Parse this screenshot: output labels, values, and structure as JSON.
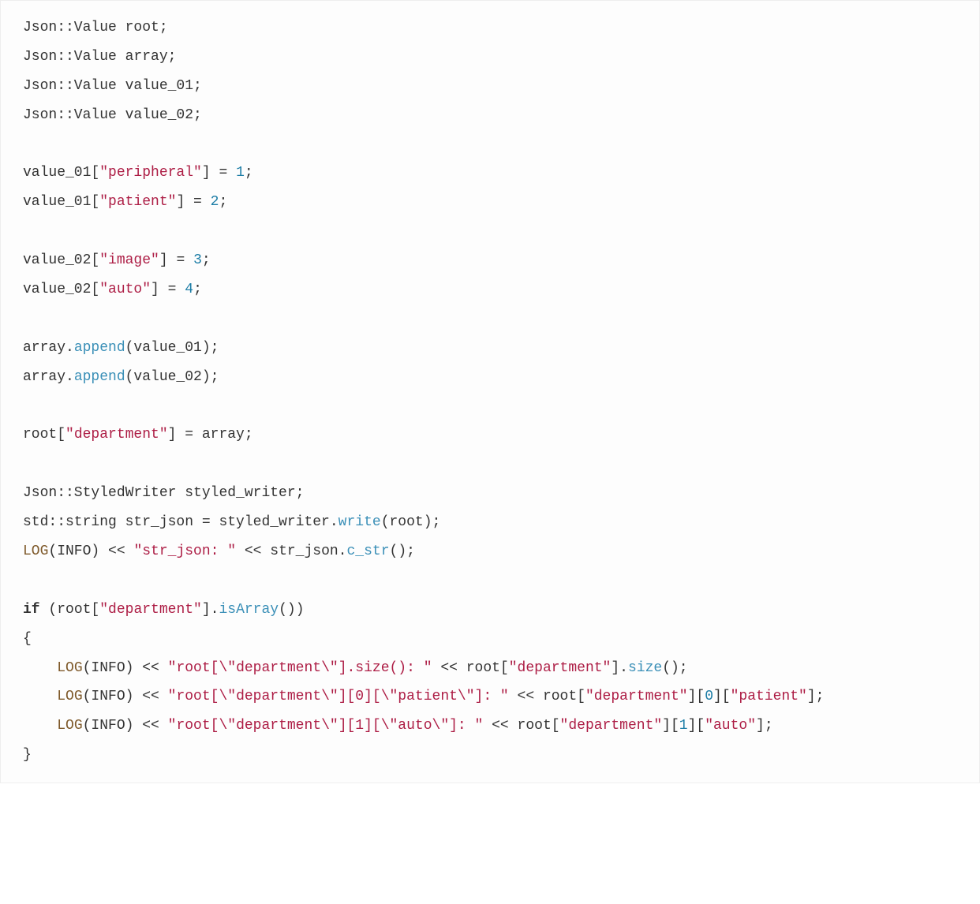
{
  "code": {
    "tokens": [
      [
        "txt",
        "Json::Value root;\n"
      ],
      [
        "txt",
        "Json::Value array;\n"
      ],
      [
        "txt",
        "Json::Value value_01;\n"
      ],
      [
        "txt",
        "Json::Value value_02;\n"
      ],
      [
        "txt",
        "\n"
      ],
      [
        "txt",
        "value_01["
      ],
      [
        "s",
        "\"peripheral\""
      ],
      [
        "txt",
        "] = "
      ],
      [
        "n",
        "1"
      ],
      [
        "txt",
        ";\n"
      ],
      [
        "txt",
        "value_01["
      ],
      [
        "s",
        "\"patient\""
      ],
      [
        "txt",
        "] = "
      ],
      [
        "n",
        "2"
      ],
      [
        "txt",
        ";\n"
      ],
      [
        "txt",
        "\n"
      ],
      [
        "txt",
        "value_02["
      ],
      [
        "s",
        "\"image\""
      ],
      [
        "txt",
        "] = "
      ],
      [
        "n",
        "3"
      ],
      [
        "txt",
        ";\n"
      ],
      [
        "txt",
        "value_02["
      ],
      [
        "s",
        "\"auto\""
      ],
      [
        "txt",
        "] = "
      ],
      [
        "n",
        "4"
      ],
      [
        "txt",
        ";\n"
      ],
      [
        "txt",
        "\n"
      ],
      [
        "txt",
        "array."
      ],
      [
        "fn",
        "append"
      ],
      [
        "txt",
        "(value_01);\n"
      ],
      [
        "txt",
        "array."
      ],
      [
        "fn",
        "append"
      ],
      [
        "txt",
        "(value_02);\n"
      ],
      [
        "txt",
        "\n"
      ],
      [
        "txt",
        "root["
      ],
      [
        "s",
        "\"department\""
      ],
      [
        "txt",
        "] = array;\n"
      ],
      [
        "txt",
        "\n"
      ],
      [
        "txt",
        "Json::StyledWriter styled_writer;\n"
      ],
      [
        "txt",
        "std::string str_json = styled_writer."
      ],
      [
        "fn",
        "write"
      ],
      [
        "txt",
        "(root);\n"
      ],
      [
        "mc",
        "LOG"
      ],
      [
        "txt",
        "(INFO) << "
      ],
      [
        "s",
        "\"str_json: \""
      ],
      [
        "txt",
        " << str_json."
      ],
      [
        "fn",
        "c_str"
      ],
      [
        "txt",
        "();\n"
      ],
      [
        "txt",
        "\n"
      ],
      [
        "kw",
        "if"
      ],
      [
        "txt",
        " (root["
      ],
      [
        "s",
        "\"department\""
      ],
      [
        "txt",
        "]."
      ],
      [
        "fn",
        "isArray"
      ],
      [
        "txt",
        "())\n"
      ],
      [
        "txt",
        "{\n"
      ],
      [
        "txt",
        "    "
      ],
      [
        "mc",
        "LOG"
      ],
      [
        "txt",
        "(INFO) << "
      ],
      [
        "s",
        "\"root[\\\"department\\\"].size(): \""
      ],
      [
        "txt",
        " << root["
      ],
      [
        "s",
        "\"department\""
      ],
      [
        "txt",
        "]."
      ],
      [
        "fn",
        "size"
      ],
      [
        "txt",
        "();\n"
      ],
      [
        "txt",
        "    "
      ],
      [
        "mc",
        "LOG"
      ],
      [
        "txt",
        "(INFO) << "
      ],
      [
        "s",
        "\"root[\\\"department\\\"][0][\\\"patient\\\"]: \""
      ],
      [
        "txt",
        " << root["
      ],
      [
        "s",
        "\"department\""
      ],
      [
        "txt",
        "]["
      ],
      [
        "n",
        "0"
      ],
      [
        "txt",
        "]["
      ],
      [
        "s",
        "\"patient\""
      ],
      [
        "txt",
        "];\n"
      ],
      [
        "txt",
        "    "
      ],
      [
        "mc",
        "LOG"
      ],
      [
        "txt",
        "(INFO) << "
      ],
      [
        "s",
        "\"root[\\\"department\\\"][1][\\\"auto\\\"]: \""
      ],
      [
        "txt",
        " << root["
      ],
      [
        "s",
        "\"department\""
      ],
      [
        "txt",
        "]["
      ],
      [
        "n",
        "1"
      ],
      [
        "txt",
        "]["
      ],
      [
        "s",
        "\"auto\""
      ],
      [
        "txt",
        "];\n"
      ],
      [
        "txt",
        "}\n"
      ]
    ]
  }
}
